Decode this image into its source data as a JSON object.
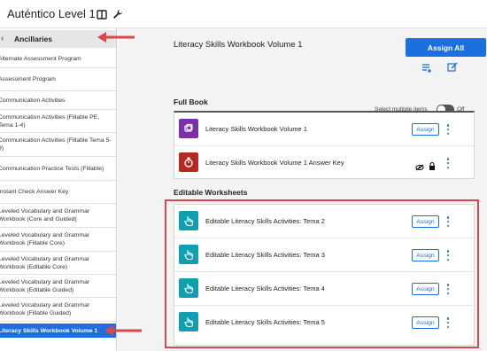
{
  "app": {
    "title": "Auténtico Level 1",
    "book_icon": "book-icon",
    "wrench_icon": "wrench-icon"
  },
  "sidebar": {
    "header": "Ancillaries",
    "items": [
      {
        "label": "Alternate Assessment Program"
      },
      {
        "label": "Assessment Program"
      },
      {
        "label": "Communication Activities"
      },
      {
        "label": "Communication Activities (Fillable PE, Tema 1-4)"
      },
      {
        "label": "Communication Activities (Fillable Tema 5-9)"
      },
      {
        "label": "Communication Practice Tests (Fillable)"
      },
      {
        "label": "Instant Check Answer Key"
      },
      {
        "label": "Leveled Vocabulary and Grammar Workbook (Core and Guided)"
      },
      {
        "label": "Leveled Vocabulary and Grammar Workbook (Fillable Core)"
      },
      {
        "label": "Leveled Vocabulary and Grammar Workbook (Editable Core)"
      },
      {
        "label": "Leveled Vocabulary and Grammar Workbook (Editable Guided)"
      },
      {
        "label": "Leveled Vocabulary and Grammar Workbook (Fillable Guided)"
      },
      {
        "label": "Literacy Skills Workbook Volume 1"
      }
    ]
  },
  "main": {
    "title": "Literacy Skills Workbook Volume 1",
    "assign_all": "Assign All",
    "select_multiple": "Select multiple items",
    "toggle_state": "Off",
    "full_book": {
      "title": "Full Book",
      "rows": [
        {
          "title": "Literacy Skills Workbook Volume 1",
          "action": "Assign",
          "icon": "workbook-icon",
          "color": "#7b2fa8"
        },
        {
          "title": "Literacy Skills Workbook Volume 1 Answer Key",
          "icon": "answer-key-icon",
          "color": "#b8281e"
        }
      ]
    },
    "editable_worksheets": {
      "title": "Editable Worksheets",
      "rows": [
        {
          "title": "Editable Literacy Skills Activities: Tema 2",
          "action": "Assign",
          "icon": "hand-pointer-icon",
          "color": "#0e9fb0"
        },
        {
          "title": "Editable Literacy Skills Activities: Tema 3",
          "action": "Assign",
          "icon": "hand-pointer-icon",
          "color": "#0e9fb0"
        },
        {
          "title": "Editable Literacy Skills Activities: Tema 4",
          "action": "Assign",
          "icon": "hand-pointer-icon",
          "color": "#0e9fb0"
        },
        {
          "title": "Editable Literacy Skills Activities: Tema 5",
          "action": "Assign",
          "icon": "hand-pointer-icon",
          "color": "#0e9fb0"
        }
      ]
    }
  },
  "colors": {
    "accent": "#1b6fe0",
    "annotation": "#d9464c"
  }
}
